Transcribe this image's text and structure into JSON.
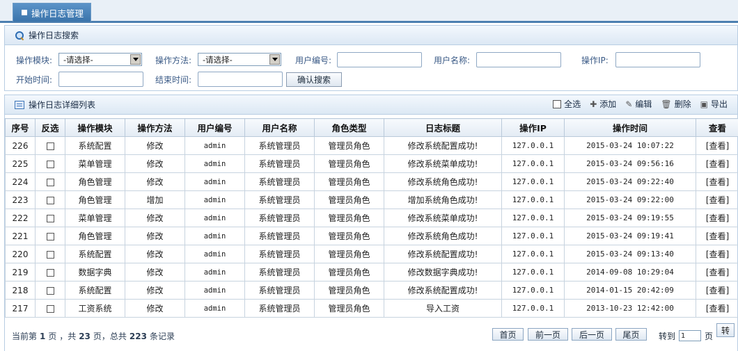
{
  "tab": {
    "title": "操作日志管理"
  },
  "search": {
    "title": "操作日志搜索",
    "module_label": "操作模块:",
    "module_value": "-请选择-",
    "method_label": "操作方法:",
    "method_value": "-请选择-",
    "user_id_label": "用户编号:",
    "user_name_label": "用户名称:",
    "ip_label": "操作IP:",
    "start_label": "开始时间:",
    "end_label": "结束时间:",
    "submit_label": "确认搜索"
  },
  "list": {
    "title": "操作日志详细列表",
    "toolbar": {
      "select_all": "全选",
      "add": "添加",
      "edit": "编辑",
      "delete": "删除",
      "export": "导出"
    },
    "columns": [
      "序号",
      "反选",
      "操作模块",
      "操作方法",
      "用户编号",
      "用户名称",
      "角色类型",
      "日志标题",
      "操作IP",
      "操作时间",
      "查看"
    ],
    "rows": [
      {
        "id": "226",
        "module": "系统配置",
        "method": "修改",
        "user_id": "admin",
        "user_name": "系统管理员",
        "role": "管理员角色",
        "title": "修改系统配置成功!",
        "ip": "127.0.0.1",
        "time": "2015-03-24 10:07:22",
        "view": "[查看]"
      },
      {
        "id": "225",
        "module": "菜单管理",
        "method": "修改",
        "user_id": "admin",
        "user_name": "系统管理员",
        "role": "管理员角色",
        "title": "修改系统菜单成功!",
        "ip": "127.0.0.1",
        "time": "2015-03-24 09:56:16",
        "view": "[查看]"
      },
      {
        "id": "224",
        "module": "角色管理",
        "method": "修改",
        "user_id": "admin",
        "user_name": "系统管理员",
        "role": "管理员角色",
        "title": "修改系统角色成功!",
        "ip": "127.0.0.1",
        "time": "2015-03-24 09:22:40",
        "view": "[查看]"
      },
      {
        "id": "223",
        "module": "角色管理",
        "method": "增加",
        "user_id": "admin",
        "user_name": "系统管理员",
        "role": "管理员角色",
        "title": "增加系统角色成功!",
        "ip": "127.0.0.1",
        "time": "2015-03-24 09:22:00",
        "view": "[查看]"
      },
      {
        "id": "222",
        "module": "菜单管理",
        "method": "修改",
        "user_id": "admin",
        "user_name": "系统管理员",
        "role": "管理员角色",
        "title": "修改系统菜单成功!",
        "ip": "127.0.0.1",
        "time": "2015-03-24 09:19:55",
        "view": "[查看]"
      },
      {
        "id": "221",
        "module": "角色管理",
        "method": "修改",
        "user_id": "admin",
        "user_name": "系统管理员",
        "role": "管理员角色",
        "title": "修改系统角色成功!",
        "ip": "127.0.0.1",
        "time": "2015-03-24 09:19:41",
        "view": "[查看]"
      },
      {
        "id": "220",
        "module": "系统配置",
        "method": "修改",
        "user_id": "admin",
        "user_name": "系统管理员",
        "role": "管理员角色",
        "title": "修改系统配置成功!",
        "ip": "127.0.0.1",
        "time": "2015-03-24 09:13:40",
        "view": "[查看]"
      },
      {
        "id": "219",
        "module": "数据字典",
        "method": "修改",
        "user_id": "admin",
        "user_name": "系统管理员",
        "role": "管理员角色",
        "title": "修改数据字典成功!",
        "ip": "127.0.0.1",
        "time": "2014-09-08 10:29:04",
        "view": "[查看]"
      },
      {
        "id": "218",
        "module": "系统配置",
        "method": "修改",
        "user_id": "admin",
        "user_name": "系统管理员",
        "role": "管理员角色",
        "title": "修改系统配置成功!",
        "ip": "127.0.0.1",
        "time": "2014-01-15 20:42:09",
        "view": "[查看]"
      },
      {
        "id": "217",
        "module": "工资系统",
        "method": "修改",
        "user_id": "admin",
        "user_name": "系统管理员",
        "role": "管理员角色",
        "title": "导入工资",
        "ip": "127.0.0.1",
        "time": "2013-10-23 12:42:00",
        "view": "[查看]"
      }
    ]
  },
  "pager": {
    "prefix": "当前第",
    "current_page": "1",
    "mid1": "页 ，共",
    "total_pages": "23",
    "mid2": "页，总共",
    "total_records": "223",
    "suffix": "条记录",
    "first": "首页",
    "prev": "前一页",
    "next": "后一页",
    "last": "尾页",
    "goto_label": "转到",
    "goto_value": "1",
    "page_unit": "页",
    "go": "转"
  }
}
